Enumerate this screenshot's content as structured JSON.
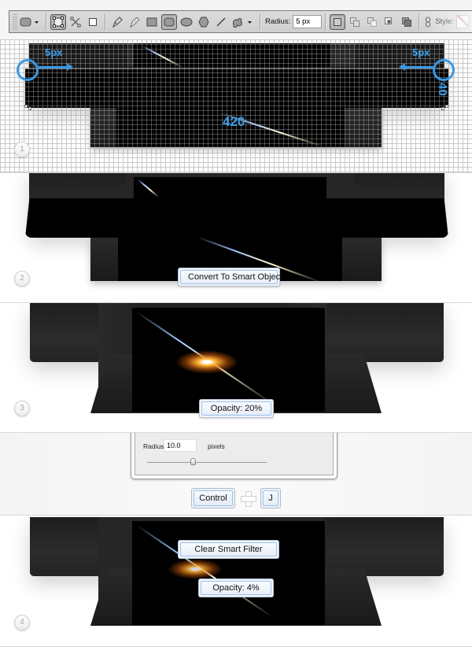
{
  "toolbar": {
    "tools": [
      {
        "name": "rounded-rectangle-preset",
        "icon": "rounded-rect-icon"
      },
      {
        "name": "shape-layers",
        "icon": "shape-layers-icon",
        "active": true
      },
      {
        "name": "paths",
        "icon": "paths-icon"
      },
      {
        "name": "fill-pixels",
        "icon": "fill-pixels-icon"
      },
      {
        "name": "pen-tool",
        "icon": "pen-icon"
      },
      {
        "name": "freeform-pen-tool",
        "icon": "freeform-pen-icon"
      },
      {
        "name": "rectangle-tool",
        "icon": "rectangle-icon"
      },
      {
        "name": "rounded-rectangle-tool",
        "icon": "rounded-rectangle-icon",
        "active": true
      },
      {
        "name": "ellipse-tool",
        "icon": "ellipse-icon"
      },
      {
        "name": "polygon-tool",
        "icon": "polygon-icon"
      },
      {
        "name": "line-tool",
        "icon": "line-icon"
      },
      {
        "name": "custom-shape-tool",
        "icon": "custom-shape-icon"
      }
    ],
    "radius_label": "Radius:",
    "radius_value": "5 px",
    "style_label": "Style:"
  },
  "steps": [
    {
      "number": "1",
      "annotations": {
        "left_offset": "5px",
        "right_offset": "5px",
        "width": "420",
        "height": "40"
      }
    },
    {
      "number": "2",
      "callout": "Convert To Smart Object"
    },
    {
      "number": "3",
      "callout": "Opacity: 20%"
    },
    {
      "dialog": {
        "radius_label": "Radius:",
        "radius_value": "10.0",
        "unit": "pixels",
        "slider_position": 0.38
      },
      "shortcut": {
        "key1": "Control",
        "key2": "J"
      }
    },
    {
      "number": "4",
      "callout_top": "Clear Smart Filter",
      "callout_bottom": "Opacity: 4%"
    }
  ],
  "colors": {
    "annotation_blue": "#3a98e4",
    "device_dark": "#1e1e1e"
  }
}
